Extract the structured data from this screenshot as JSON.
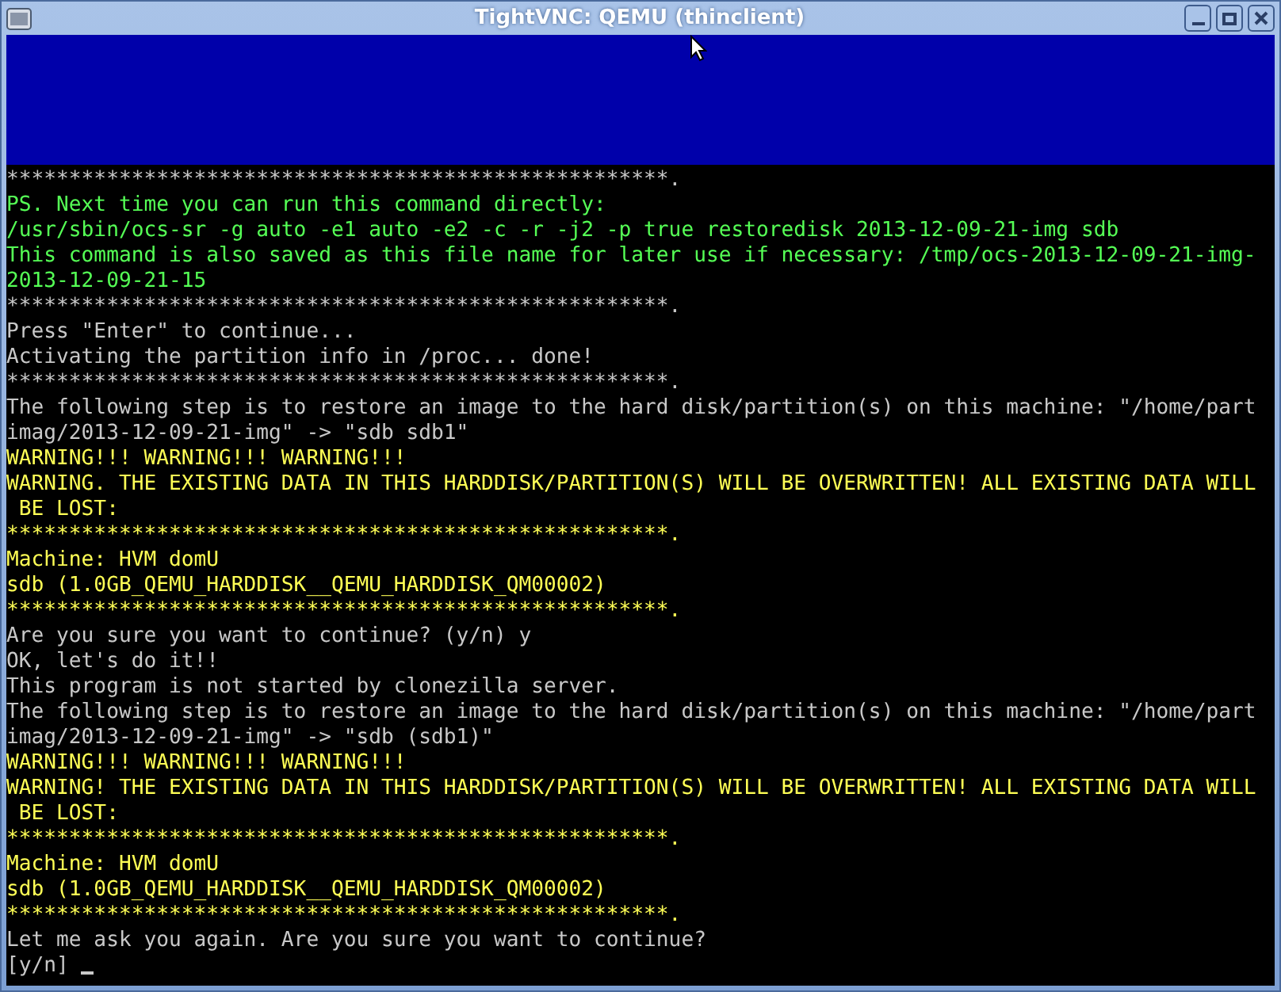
{
  "window": {
    "title": "TightVNC: QEMU (thinclient)"
  },
  "terminal": {
    "lines": [
      {
        "text": "*****************************************************.",
        "color": "#c8c8c8"
      },
      {
        "text": "PS. Next time you can run this command directly:",
        "color": "#55ff55"
      },
      {
        "text": "/usr/sbin/ocs-sr -g auto -e1 auto -e2 -c -r -j2 -p true restoredisk 2013-12-09-21-img sdb",
        "color": "#55ff55"
      },
      {
        "text": "This command is also saved as this file name for later use if necessary: /tmp/ocs-2013-12-09-21-img-",
        "color": "#55ff55"
      },
      {
        "text": "2013-12-09-21-15",
        "color": "#55ff55"
      },
      {
        "text": "*****************************************************.",
        "color": "#c8c8c8"
      },
      {
        "text": "Press \"Enter\" to continue...",
        "color": "#c8c8c8"
      },
      {
        "text": "Activating the partition info in /proc... done!",
        "color": "#c8c8c8"
      },
      {
        "text": "*****************************************************.",
        "color": "#c8c8c8"
      },
      {
        "text": "The following step is to restore an image to the hard disk/partition(s) on this machine: \"/home/part",
        "color": "#c8c8c8"
      },
      {
        "text": "imag/2013-12-09-21-img\" -> \"sdb sdb1\"",
        "color": "#c8c8c8"
      },
      {
        "text": "WARNING!!! WARNING!!! WARNING!!!",
        "color": "#ffff55"
      },
      {
        "text": "WARNING. THE EXISTING DATA IN THIS HARDDISK/PARTITION(S) WILL BE OVERWRITTEN! ALL EXISTING DATA WILL",
        "color": "#ffff55"
      },
      {
        "text": " BE LOST:",
        "color": "#ffff55"
      },
      {
        "text": "*****************************************************.",
        "color": "#ffff55"
      },
      {
        "text": "Machine: HVM domU",
        "color": "#ffff55"
      },
      {
        "text": "sdb (1.0GB_QEMU_HARDDISK__QEMU_HARDDISK_QM00002)",
        "color": "#ffff55"
      },
      {
        "text": "*****************************************************.",
        "color": "#ffff55"
      },
      {
        "text": "Are you sure you want to continue? (y/n) y",
        "color": "#c8c8c8"
      },
      {
        "text": "OK, let's do it!!",
        "color": "#c8c8c8"
      },
      {
        "text": "This program is not started by clonezilla server.",
        "color": "#c8c8c8"
      },
      {
        "text": "The following step is to restore an image to the hard disk/partition(s) on this machine: \"/home/part",
        "color": "#c8c8c8"
      },
      {
        "text": "imag/2013-12-09-21-img\" -> \"sdb (sdb1)\"",
        "color": "#c8c8c8"
      },
      {
        "text": "WARNING!!! WARNING!!! WARNING!!!",
        "color": "#ffff55"
      },
      {
        "text": "WARNING! THE EXISTING DATA IN THIS HARDDISK/PARTITION(S) WILL BE OVERWRITTEN! ALL EXISTING DATA WILL",
        "color": "#ffff55"
      },
      {
        "text": " BE LOST:",
        "color": "#ffff55"
      },
      {
        "text": "*****************************************************.",
        "color": "#ffff55"
      },
      {
        "text": "Machine: HVM domU",
        "color": "#ffff55"
      },
      {
        "text": "sdb (1.0GB_QEMU_HARDDISK__QEMU_HARDDISK_QM00002)",
        "color": "#ffff55"
      },
      {
        "text": "*****************************************************.",
        "color": "#ffff55"
      },
      {
        "text": "Let me ask you again. Are you sure you want to continue?",
        "color": "#c8c8c8"
      }
    ],
    "prompt": {
      "text": "[y/n]",
      "color": "#c8c8c8",
      "cursor": true
    }
  }
}
